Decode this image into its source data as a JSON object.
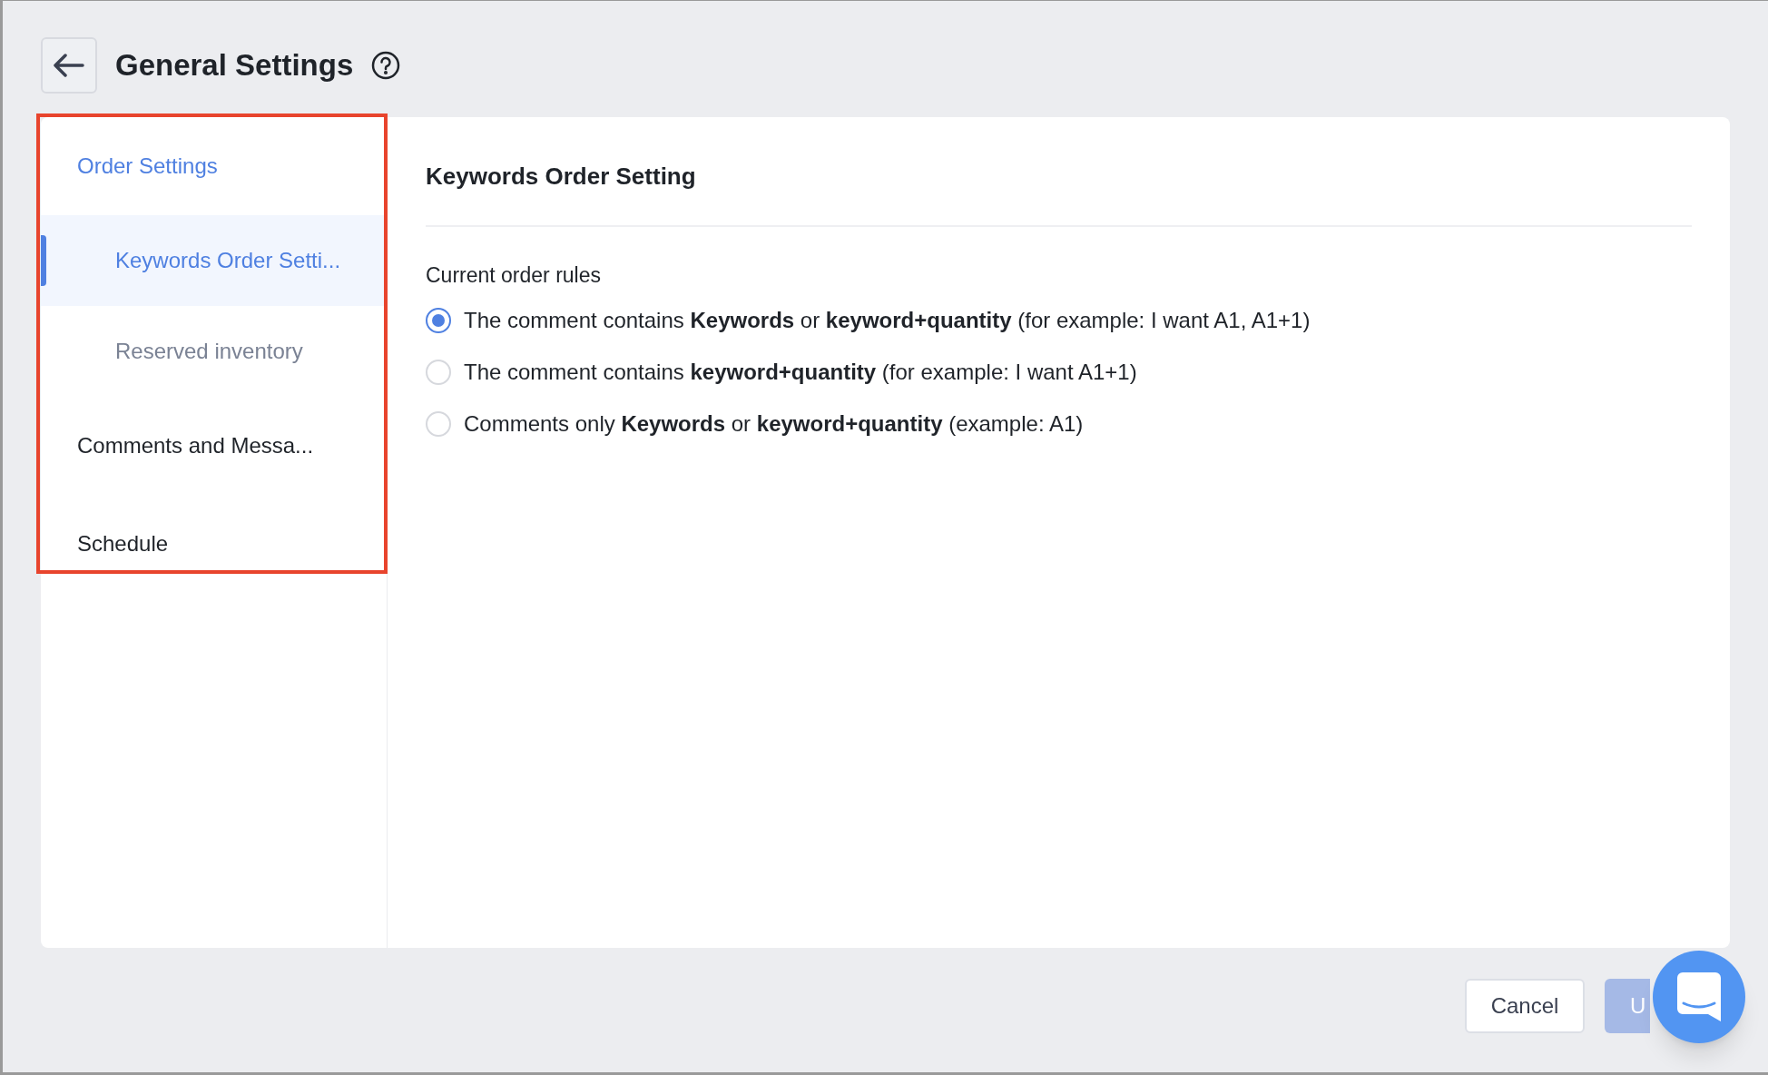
{
  "header": {
    "title": "General Settings"
  },
  "sidebar": {
    "items": [
      {
        "label": "Order Settings",
        "selected": false,
        "children": [
          {
            "label": "Keywords Order Setti...",
            "selected": true
          },
          {
            "label": "Reserved inventory",
            "selected": false
          }
        ]
      },
      {
        "label": "Comments and Messa...",
        "selected": false
      },
      {
        "label": "Schedule",
        "selected": false
      }
    ]
  },
  "content": {
    "title": "Keywords Order Setting",
    "rules_label": "Current order rules",
    "options": [
      {
        "text": "The comment contains **Keywords** or **keyword+quantity** (for example: I want A1, A1+1)",
        "selected": true
      },
      {
        "text": "The comment contains **keyword+quantity** (for example: I want A1+1)",
        "selected": false
      },
      {
        "text": "Comments only **Keywords** or **keyword+quantity** (example: A1)",
        "selected": false
      }
    ]
  },
  "footer": {
    "buttons": [
      {
        "label": "Cancel",
        "kind": "secondary"
      },
      {
        "label": "U",
        "kind": "primary"
      }
    ]
  }
}
